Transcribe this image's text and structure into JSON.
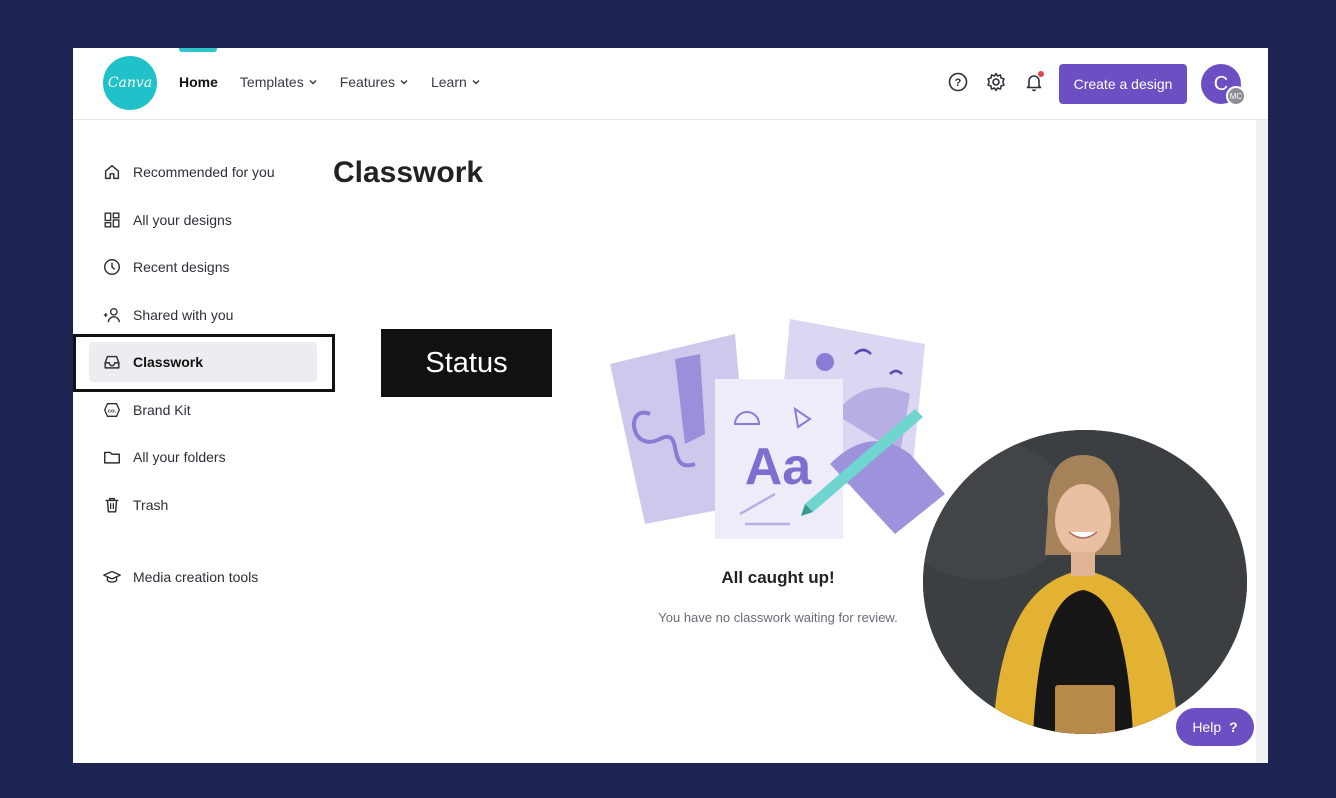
{
  "colors": {
    "background": "#1e2452",
    "accent": "#6c4fc2",
    "brand": "#20c1c8"
  },
  "header": {
    "logo_text": "Canva",
    "nav": [
      {
        "label": "Home",
        "active": true
      },
      {
        "label": "Templates",
        "dropdown": true
      },
      {
        "label": "Features",
        "dropdown": true
      },
      {
        "label": "Learn",
        "dropdown": true
      }
    ],
    "icons": [
      "help-icon",
      "settings-icon",
      "bell-icon"
    ],
    "create_label": "Create a design",
    "avatar_letter": "C",
    "avatar_badge": "MC"
  },
  "sidebar": {
    "items": [
      {
        "label": "Recommended for you",
        "icon": "home-icon"
      },
      {
        "label": "All your designs",
        "icon": "grid-icon"
      },
      {
        "label": "Recent designs",
        "icon": "clock-icon"
      },
      {
        "label": "Shared with you",
        "icon": "people-icon"
      },
      {
        "label": "Classwork",
        "icon": "inbox-icon",
        "active": true
      },
      {
        "label": "Brand Kit",
        "icon": "brand-kit-icon"
      },
      {
        "label": "All your folders",
        "icon": "folder-icon"
      },
      {
        "label": "Trash",
        "icon": "trash-icon"
      },
      {
        "label": "Media creation tools",
        "icon": "graduation-cap-icon"
      }
    ]
  },
  "main": {
    "title": "Classwork",
    "empty_title": "All caught up!",
    "empty_subtitle": "You have no classwork waiting for review."
  },
  "annotation": {
    "label": "Status"
  },
  "help": {
    "label": "Help",
    "icon": "?"
  }
}
